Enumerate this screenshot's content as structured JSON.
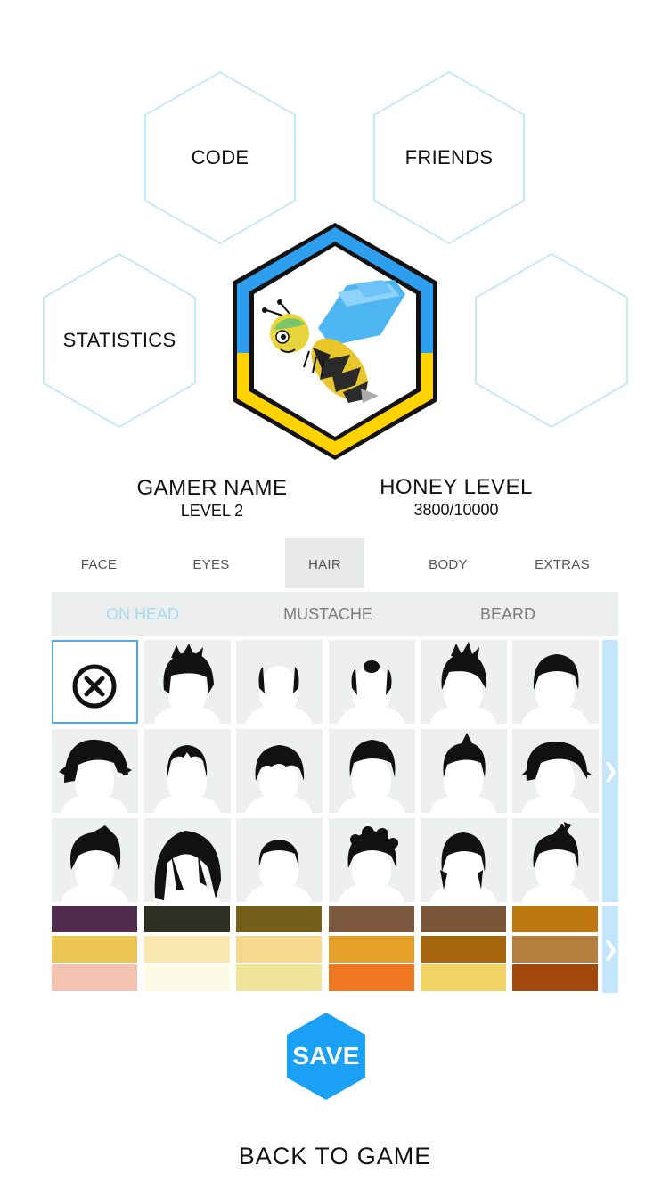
{
  "menu": {
    "code_label": "CODE",
    "friends_label": "FRIENDS",
    "statistics_label": "STATISTICS",
    "empty_label": ""
  },
  "avatar": {
    "icon": "bee-icon",
    "border_top_color": "#2e9fef",
    "border_bottom_color": "#ffd200"
  },
  "player": {
    "name_label": "GAMER NAME",
    "level_label": "LEVEL 2",
    "honey_label": "HONEY LEVEL",
    "honey_value": "3800/10000",
    "honey_progress": 0.38
  },
  "tabs": [
    {
      "label": "FACE",
      "active": false
    },
    {
      "label": "EYES",
      "active": false
    },
    {
      "label": "HAIR",
      "active": true
    },
    {
      "label": "BODY",
      "active": false
    },
    {
      "label": "EXTRAS",
      "active": false
    }
  ],
  "subtabs": [
    {
      "label": "ON HEAD",
      "active": true
    },
    {
      "label": "MUSTACHE",
      "active": false
    },
    {
      "label": "BEARD",
      "active": false
    }
  ],
  "hair_styles": [
    "none-icon",
    "messy-hair-icon",
    "bald-sides-icon",
    "bald-top-icon",
    "spiky-hair-icon",
    "side-part-hair-icon",
    "shaggy-hair-icon",
    "receding-hair-icon",
    "wavy-hair-icon",
    "pompadour-hair-icon",
    "quiff-hair-icon",
    "emo-hair-icon",
    "swept-hair-icon",
    "long-bob-hair-icon",
    "buzz-cut-icon",
    "curly-hair-icon",
    "sideburns-hair-icon",
    "faux-hawk-icon"
  ],
  "selected_style_index": 0,
  "hair_colors": [
    [
      "#522c4e",
      "#2c2f22",
      "#74601b",
      "#7a573d",
      "#7a563b",
      "#bd7812"
    ],
    [
      "#ecc455",
      "#f9e8b0",
      "#f8d88d",
      "#e5a02a",
      "#a7650e",
      "#b5803f"
    ],
    [
      "#f3c2b1",
      "#fdfbe5",
      "#f0e59b",
      "#f07721",
      "#f1d366",
      "#a3480c"
    ]
  ],
  "next_arrow": "chevron-right-icon",
  "save_label": "SAVE",
  "save_color": "#1aa0f5",
  "back_label": "BACK TO GAME"
}
